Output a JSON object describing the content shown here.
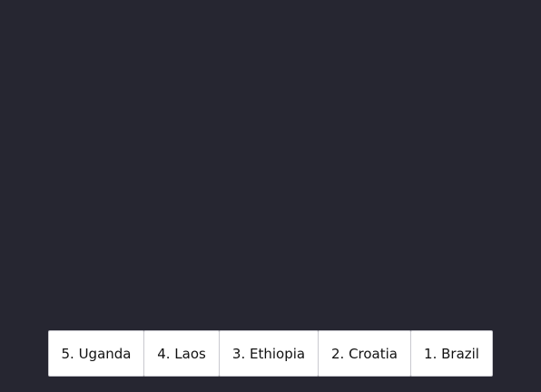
{
  "options": [
    {
      "label": "5. Uganda"
    },
    {
      "label": "4. Laos"
    },
    {
      "label": "3. Ethiopia"
    },
    {
      "label": "2. Croatia"
    },
    {
      "label": "1. Brazil"
    }
  ],
  "colors": {
    "background": "#262631",
    "button_bg": "#ffffff",
    "button_text": "#111111",
    "button_border": "#c9c9cf"
  }
}
